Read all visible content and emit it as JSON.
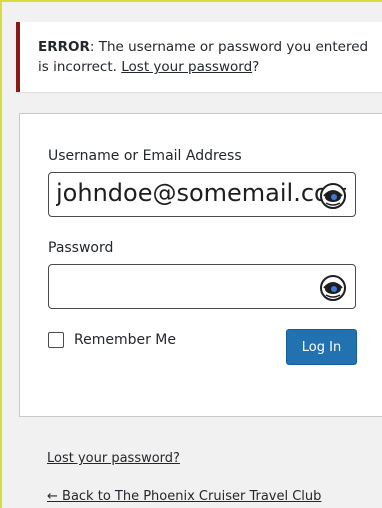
{
  "error": {
    "prefix": "ERROR",
    "message": ": The username or password you entered is incorrect. ",
    "link_text": "Lost your password",
    "suffix": "?"
  },
  "form": {
    "username_label": "Username or Email Address",
    "username_value": "johndoe@somemail.com",
    "password_label": "Password",
    "password_value": "",
    "remember_label": "Remember Me",
    "remember_checked": false,
    "login_button": "Log In"
  },
  "footer": {
    "lost_password": "Lost your password?",
    "back_link": "← Back to The Phoenix Cruiser Travel Club"
  },
  "icons": {
    "field_icon": "password-manager-eye-icon"
  },
  "colors": {
    "primary_button": "#2271b1",
    "error_border": "#8a1a1a",
    "background": "#f1f1f1"
  }
}
